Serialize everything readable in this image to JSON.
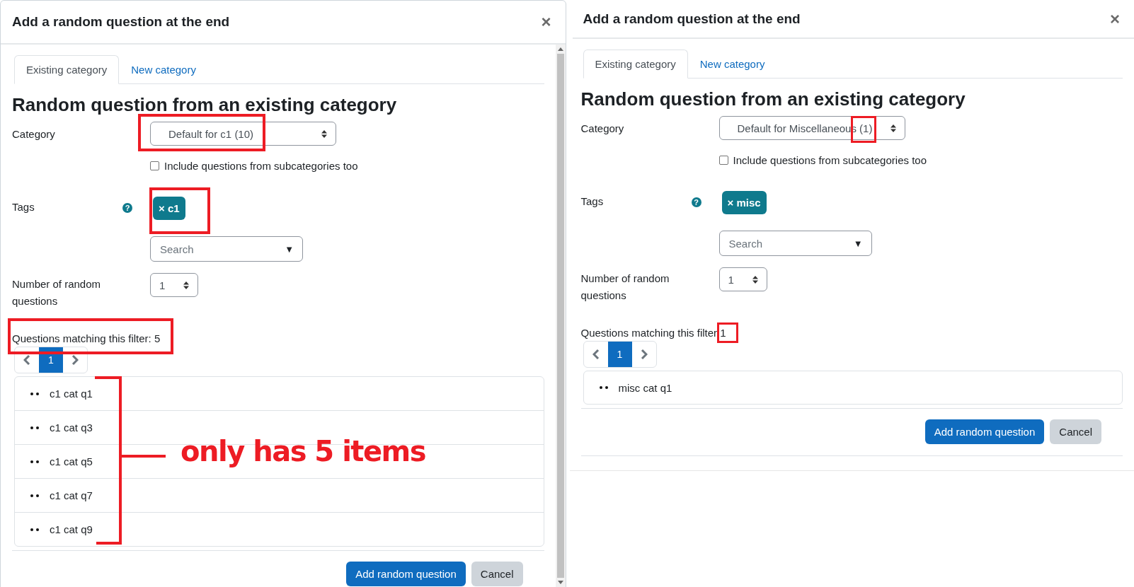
{
  "panels": [
    {
      "title": "Add a random question at the end",
      "close": "×",
      "scrollbar": true,
      "tabs": [
        {
          "label": "Existing category",
          "selected": true
        },
        {
          "label": "New category",
          "selected": false
        }
      ],
      "heading": "Random question from an existing category",
      "category": {
        "label": "Category",
        "name": "Default for c1",
        "count": "(10)",
        "highlighted": true
      },
      "subcategories": {
        "label": "Include questions from subcategories too",
        "checked": false
      },
      "tags": {
        "label": "Tags",
        "help": "?",
        "items": [
          {
            "label": "× c1"
          }
        ],
        "highlight": true,
        "search": {
          "placeholder": "Search",
          "caret": "▼"
        }
      },
      "number": {
        "label": "Number of random questions",
        "value": "1"
      },
      "filter": {
        "label": "Questions matching this filter:",
        "count": "5",
        "highlighted": true
      },
      "pages": [
        {
          "label": "1",
          "selected": true
        }
      ],
      "questions": [
        {
          "label": "c1 cat q1"
        },
        {
          "label": "c1 cat q3"
        },
        {
          "label": "c1 cat q5"
        },
        {
          "label": "c1 cat q7"
        },
        {
          "label": "c1 cat q9"
        }
      ],
      "note": "only has 5 items",
      "buttons": [
        {
          "label": "Add random question",
          "kind": "primary"
        },
        {
          "label": "Cancel",
          "kind": "secondary"
        }
      ]
    },
    {
      "title": "Add a random question at the end",
      "close": "×",
      "tabs": [
        {
          "label": "Existing category",
          "selected": true
        },
        {
          "label": "New category",
          "selected": false
        }
      ],
      "heading": "Random question from an existing category",
      "category": {
        "label": "Category",
        "name": "Default for Miscellaneous",
        "count": "(1)",
        "count_highlighted": true
      },
      "subcategories": {
        "label": "Include questions from subcategories too",
        "checked": false
      },
      "tags": {
        "label": "Tags",
        "help": "?",
        "items": [
          {
            "label": "× misc"
          }
        ],
        "search": {
          "placeholder": "Search",
          "caret": "▼"
        }
      },
      "number": {
        "label": "Number of random questions",
        "value": "1"
      },
      "filter": {
        "label": "Questions matching this filter",
        "count": "1",
        "count_highlighted": true
      },
      "pages": [
        {
          "label": "1",
          "selected": true
        }
      ],
      "questions": [
        {
          "label": "misc cat q1"
        }
      ],
      "buttons": [
        {
          "label": "Add random question",
          "kind": "primary"
        },
        {
          "label": "Cancel",
          "kind": "secondary"
        }
      ]
    }
  ]
}
